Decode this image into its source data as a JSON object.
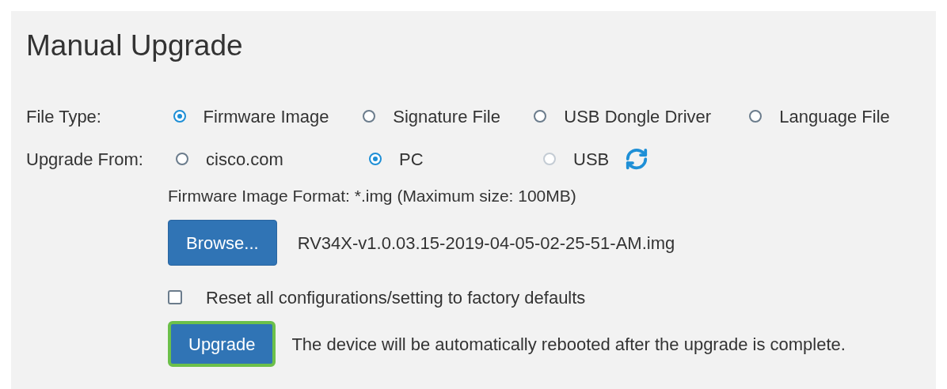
{
  "title": "Manual Upgrade",
  "file_type": {
    "label": "File Type:",
    "options": [
      {
        "label": "Firmware Image",
        "selected": true,
        "disabled": false
      },
      {
        "label": "Signature File",
        "selected": false,
        "disabled": false
      },
      {
        "label": "USB Dongle Driver",
        "selected": false,
        "disabled": false
      },
      {
        "label": "Language File",
        "selected": false,
        "disabled": false
      }
    ]
  },
  "upgrade_from": {
    "label": "Upgrade From:",
    "options": [
      {
        "label": "cisco.com",
        "selected": false,
        "disabled": false
      },
      {
        "label": "PC",
        "selected": true,
        "disabled": false
      },
      {
        "label": "USB",
        "selected": false,
        "disabled": true
      }
    ]
  },
  "format_note": "Firmware Image Format: *.img (Maximum size: 100MB)",
  "browse_button": "Browse...",
  "file_name": "RV34X-v1.0.03.15-2019-04-05-02-25-51-AM.img",
  "reset_checkbox": {
    "label": "Reset all configurations/setting to factory defaults",
    "checked": false
  },
  "upgrade_button": {
    "label": "Upgrade",
    "highlighted": true
  },
  "upgrade_note": "The device will be automatically rebooted after the upgrade is complete."
}
